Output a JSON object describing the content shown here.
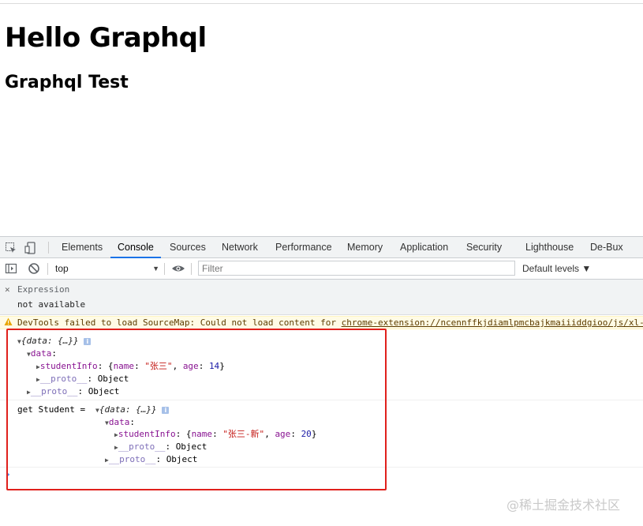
{
  "page": {
    "heading1": "Hello Graphql",
    "heading2": "Graphql Test"
  },
  "devtools": {
    "tabs": [
      "Elements",
      "Console",
      "Sources",
      "Network",
      "Performance",
      "Memory",
      "Application",
      "Security",
      "Lighthouse",
      "De-Bux"
    ],
    "active_tab": "Console",
    "context": "top",
    "filter_placeholder": "Filter",
    "levels": "Default levels ▼",
    "expression": {
      "label": "Expression",
      "value": "not available"
    },
    "warning": {
      "text": "DevTools failed to load SourceMap: Could not load content for ",
      "link": "chrome-extension://ncennffkjdiamlpmcbajkmaiiiddgioo/js/xl-"
    },
    "log1": {
      "summary": "{data: {…}}",
      "data_key": "data",
      "studentInfo_key": "studentInfo",
      "name_value": "\"张三\"",
      "age_value": "14",
      "proto_label": "__proto__",
      "object_label": "Object"
    },
    "log2": {
      "prefix": "get Student = ",
      "summary": "{data: {…}}",
      "data_key": "data",
      "studentInfo_key": "studentInfo",
      "name_value": "\"张三-新\"",
      "age_value": "20",
      "proto_label": "__proto__",
      "object_label": "Object"
    },
    "prompt": "›"
  },
  "watermark": "@稀土掘金技术社区",
  "colors": {
    "accent_tab": "#1a73e8",
    "highlight_box": "#e0201c",
    "prop": "#881391",
    "string": "#c41a16",
    "number": "#1a1aa6"
  }
}
